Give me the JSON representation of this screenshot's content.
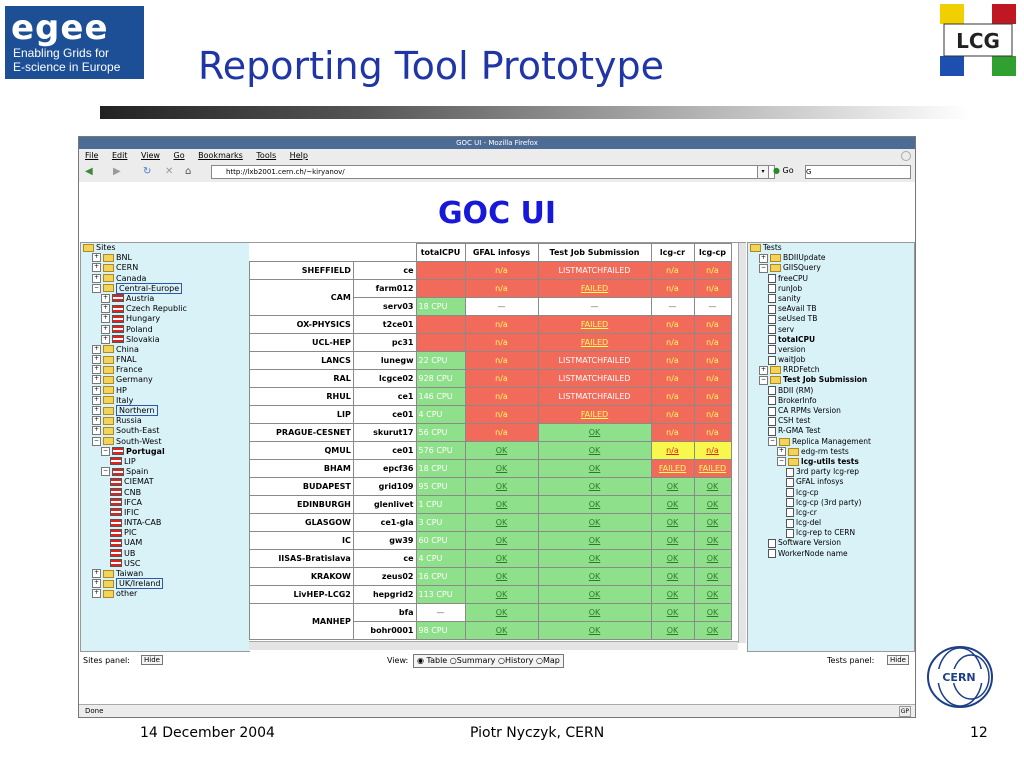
{
  "slide": {
    "logo_word": "egee",
    "logo_sub_line1": "Enabling Grids for",
    "logo_sub_line2": "E-science in Europe",
    "title": "Reporting Tool Prototype",
    "lcg_label": "LCG",
    "cern_label": "CERN",
    "footer_date": "14 December 2004",
    "footer_author": "Piotr Nyczyk, CERN",
    "footer_page": "12"
  },
  "browser": {
    "window_title": "GOC UI - Mozilla Firefox",
    "menu": [
      "File",
      "Edit",
      "View",
      "Go",
      "Bookmarks",
      "Tools",
      "Help"
    ],
    "url": "http://lxb2001.cern.ch/~kiryanov/",
    "go_label": "Go",
    "search_value": "G",
    "status_text": "Done",
    "status_right": "GP"
  },
  "page": {
    "heading": "GOC UI",
    "sites_panel_label": "Sites panel:",
    "tests_panel_label": "Tests panel:",
    "hide_label": "Hide",
    "view_label": "View:",
    "view_options": [
      "Table",
      "Summary",
      "History",
      "Map"
    ],
    "view_selected": "Table"
  },
  "sites_tree": [
    {
      "label": "Sites",
      "depth": 0,
      "icon": "folder"
    },
    {
      "label": "BNL",
      "depth": 1,
      "icon": "folder"
    },
    {
      "label": "CERN",
      "depth": 1,
      "icon": "folder"
    },
    {
      "label": "Canada",
      "depth": 1,
      "icon": "folder"
    },
    {
      "label": "Central-Europe",
      "depth": 1,
      "icon": "folder",
      "selected": true
    },
    {
      "label": "Austria",
      "depth": 2,
      "icon": "flag"
    },
    {
      "label": "Czech Republic",
      "depth": 2,
      "icon": "flag"
    },
    {
      "label": "Hungary",
      "depth": 2,
      "icon": "flag"
    },
    {
      "label": "Poland",
      "depth": 2,
      "icon": "flag"
    },
    {
      "label": "Slovakia",
      "depth": 2,
      "icon": "flag"
    },
    {
      "label": "China",
      "depth": 1,
      "icon": "folder"
    },
    {
      "label": "FNAL",
      "depth": 1,
      "icon": "folder"
    },
    {
      "label": "France",
      "depth": 1,
      "icon": "folder"
    },
    {
      "label": "Germany",
      "depth": 1,
      "icon": "folder"
    },
    {
      "label": "HP",
      "depth": 1,
      "icon": "folder"
    },
    {
      "label": "Italy",
      "depth": 1,
      "icon": "folder"
    },
    {
      "label": "Northern",
      "depth": 1,
      "icon": "folder",
      "selected": true
    },
    {
      "label": "Russia",
      "depth": 1,
      "icon": "folder"
    },
    {
      "label": "South-East",
      "depth": 1,
      "icon": "folder"
    },
    {
      "label": "South-West",
      "depth": 1,
      "icon": "folder"
    },
    {
      "label": "Portugal",
      "depth": 2,
      "icon": "flag",
      "bold": true
    },
    {
      "label": "LIP",
      "depth": 3,
      "icon": "flag"
    },
    {
      "label": "Spain",
      "depth": 2,
      "icon": "flag"
    },
    {
      "label": "CIEMAT",
      "depth": 3,
      "icon": "flag"
    },
    {
      "label": "CNB",
      "depth": 3,
      "icon": "flag"
    },
    {
      "label": "IFCA",
      "depth": 3,
      "icon": "flag"
    },
    {
      "label": "IFIC",
      "depth": 3,
      "icon": "flag"
    },
    {
      "label": "INTA-CAB",
      "depth": 3,
      "icon": "flag"
    },
    {
      "label": "PIC",
      "depth": 3,
      "icon": "flag"
    },
    {
      "label": "UAM",
      "depth": 3,
      "icon": "flag"
    },
    {
      "label": "UB",
      "depth": 3,
      "icon": "flag"
    },
    {
      "label": "USC",
      "depth": 3,
      "icon": "flag"
    },
    {
      "label": "Taiwan",
      "depth": 1,
      "icon": "folder"
    },
    {
      "label": "UK/Ireland",
      "depth": 1,
      "icon": "folder",
      "selected": true
    },
    {
      "label": "other",
      "depth": 1,
      "icon": "folder"
    }
  ],
  "tests_tree": [
    {
      "label": "Tests",
      "depth": 0,
      "icon": "folder"
    },
    {
      "label": "BDIIUpdate",
      "depth": 1,
      "icon": "folder"
    },
    {
      "label": "GIISQuery",
      "depth": 1,
      "icon": "folder"
    },
    {
      "label": "freeCPU",
      "depth": 2,
      "icon": "doc"
    },
    {
      "label": "runJob",
      "depth": 2,
      "icon": "doc"
    },
    {
      "label": "sanity",
      "depth": 2,
      "icon": "doc"
    },
    {
      "label": "seAvail TB",
      "depth": 2,
      "icon": "doc"
    },
    {
      "label": "seUsed TB",
      "depth": 2,
      "icon": "doc"
    },
    {
      "label": "serv",
      "depth": 2,
      "icon": "doc"
    },
    {
      "label": "totalCPU",
      "depth": 2,
      "icon": "doc",
      "bold": true
    },
    {
      "label": "version",
      "depth": 2,
      "icon": "doc"
    },
    {
      "label": "waitJob",
      "depth": 2,
      "icon": "doc"
    },
    {
      "label": "RRDFetch",
      "depth": 1,
      "icon": "folder"
    },
    {
      "label": "Test Job Submission",
      "depth": 1,
      "icon": "folder",
      "bold": true
    },
    {
      "label": "BDII (RM)",
      "depth": 2,
      "icon": "doc"
    },
    {
      "label": "BrokerInfo",
      "depth": 2,
      "icon": "doc"
    },
    {
      "label": "CA RPMs Version",
      "depth": 2,
      "icon": "doc"
    },
    {
      "label": "CSH test",
      "depth": 2,
      "icon": "doc"
    },
    {
      "label": "R-GMA Test",
      "depth": 2,
      "icon": "doc"
    },
    {
      "label": "Replica Management",
      "depth": 2,
      "icon": "folder"
    },
    {
      "label": "edg-rm tests",
      "depth": 3,
      "icon": "folder"
    },
    {
      "label": "lcg-utils tests",
      "depth": 3,
      "icon": "folder",
      "bold": true
    },
    {
      "label": "3rd party lcg-rep",
      "depth": 4,
      "icon": "doc"
    },
    {
      "label": "GFAL infosys",
      "depth": 4,
      "icon": "doc"
    },
    {
      "label": "lcg-cp",
      "depth": 4,
      "icon": "doc"
    },
    {
      "label": "lcg-cp (3rd party)",
      "depth": 4,
      "icon": "doc"
    },
    {
      "label": "lcg-cr",
      "depth": 4,
      "icon": "doc"
    },
    {
      "label": "lcg-del",
      "depth": 4,
      "icon": "doc"
    },
    {
      "label": "lcg-rep to CERN",
      "depth": 4,
      "icon": "doc"
    },
    {
      "label": "Software Version",
      "depth": 2,
      "icon": "doc"
    },
    {
      "label": "WorkerNode name",
      "depth": 2,
      "icon": "doc"
    }
  ],
  "table": {
    "columns": [
      "totalCPU",
      "GFAL infosys",
      "Test Job Submission",
      "lcg-cr",
      "lcg-cp"
    ],
    "rows": [
      {
        "site": "SHEFFIELD",
        "host": "ce",
        "cells": [
          [
            "",
            "red"
          ],
          [
            "n/a",
            "red"
          ],
          [
            "LISTMATCHFAILED",
            "red"
          ],
          [
            "n/a",
            "red"
          ],
          [
            "n/a",
            "red"
          ]
        ]
      },
      {
        "site": "CAM",
        "host": "farm012",
        "cells": [
          [
            "",
            "red"
          ],
          [
            "n/a",
            "red"
          ],
          [
            "FAILED",
            "redu"
          ],
          [
            "n/a",
            "red"
          ],
          [
            "n/a",
            "red"
          ]
        ]
      },
      {
        "site": "",
        "host": "serv03",
        "cells": [
          [
            "18 CPU",
            "green"
          ],
          [
            "—",
            "white"
          ],
          [
            "—",
            "white"
          ],
          [
            "—",
            "white"
          ],
          [
            "—",
            "white"
          ]
        ]
      },
      {
        "site": "OX-PHYSICS",
        "host": "t2ce01",
        "cells": [
          [
            "",
            "red"
          ],
          [
            "n/a",
            "red"
          ],
          [
            "FAILED",
            "redu"
          ],
          [
            "n/a",
            "red"
          ],
          [
            "n/a",
            "red"
          ]
        ]
      },
      {
        "site": "UCL-HEP",
        "host": "pc31",
        "cells": [
          [
            "",
            "red"
          ],
          [
            "n/a",
            "red"
          ],
          [
            "FAILED",
            "redu"
          ],
          [
            "n/a",
            "red"
          ],
          [
            "n/a",
            "red"
          ]
        ]
      },
      {
        "site": "LANCS",
        "host": "lunegw",
        "cells": [
          [
            "22 CPU",
            "green"
          ],
          [
            "n/a",
            "red"
          ],
          [
            "LISTMATCHFAILED",
            "red"
          ],
          [
            "n/a",
            "red"
          ],
          [
            "n/a",
            "red"
          ]
        ]
      },
      {
        "site": "RAL",
        "host": "lcgce02",
        "cells": [
          [
            "928 CPU",
            "green"
          ],
          [
            "n/a",
            "red"
          ],
          [
            "LISTMATCHFAILED",
            "red"
          ],
          [
            "n/a",
            "red"
          ],
          [
            "n/a",
            "red"
          ]
        ]
      },
      {
        "site": "RHUL",
        "host": "ce1",
        "cells": [
          [
            "146 CPU",
            "green"
          ],
          [
            "n/a",
            "red"
          ],
          [
            "LISTMATCHFAILED",
            "red"
          ],
          [
            "n/a",
            "red"
          ],
          [
            "n/a",
            "red"
          ]
        ]
      },
      {
        "site": "LIP",
        "host": "ce01",
        "cells": [
          [
            "4 CPU",
            "green"
          ],
          [
            "n/a",
            "red"
          ],
          [
            "FAILED",
            "redu"
          ],
          [
            "n/a",
            "red"
          ],
          [
            "n/a",
            "red"
          ]
        ]
      },
      {
        "site": "PRAGUE-CESNET",
        "host": "skurut17",
        "cells": [
          [
            "56 CPU",
            "green"
          ],
          [
            "n/a",
            "red"
          ],
          [
            "OK",
            "green"
          ],
          [
            "n/a",
            "red"
          ],
          [
            "n/a",
            "red"
          ]
        ]
      },
      {
        "site": "QMUL",
        "host": "ce01",
        "cells": [
          [
            "576 CPU",
            "green"
          ],
          [
            "OK",
            "green"
          ],
          [
            "OK",
            "green"
          ],
          [
            "n/a",
            "yellow"
          ],
          [
            "n/a",
            "yellow"
          ]
        ]
      },
      {
        "site": "BHAM",
        "host": "epcf36",
        "cells": [
          [
            "18 CPU",
            "green"
          ],
          [
            "OK",
            "green"
          ],
          [
            "OK",
            "green"
          ],
          [
            "FAILED",
            "redy"
          ],
          [
            "FAILED",
            "redy"
          ]
        ]
      },
      {
        "site": "BUDAPEST",
        "host": "grid109",
        "cells": [
          [
            "95 CPU",
            "green"
          ],
          [
            "OK",
            "green"
          ],
          [
            "OK",
            "green"
          ],
          [
            "OK",
            "green"
          ],
          [
            "OK",
            "green"
          ]
        ]
      },
      {
        "site": "EDINBURGH",
        "host": "glenlivet",
        "cells": [
          [
            "1 CPU",
            "green"
          ],
          [
            "OK",
            "green"
          ],
          [
            "OK",
            "green"
          ],
          [
            "OK",
            "green"
          ],
          [
            "OK",
            "green"
          ]
        ]
      },
      {
        "site": "GLASGOW",
        "host": "ce1-gla",
        "cells": [
          [
            "3 CPU",
            "green"
          ],
          [
            "OK",
            "green"
          ],
          [
            "OK",
            "green"
          ],
          [
            "OK",
            "green"
          ],
          [
            "OK",
            "green"
          ]
        ]
      },
      {
        "site": "IC",
        "host": "gw39",
        "cells": [
          [
            "60 CPU",
            "green"
          ],
          [
            "OK",
            "green"
          ],
          [
            "OK",
            "green"
          ],
          [
            "OK",
            "green"
          ],
          [
            "OK",
            "green"
          ]
        ]
      },
      {
        "site": "IISAS-Bratislava",
        "host": "ce",
        "cells": [
          [
            "4 CPU",
            "green"
          ],
          [
            "OK",
            "green"
          ],
          [
            "OK",
            "green"
          ],
          [
            "OK",
            "green"
          ],
          [
            "OK",
            "green"
          ]
        ]
      },
      {
        "site": "KRAKOW",
        "host": "zeus02",
        "cells": [
          [
            "16 CPU",
            "green"
          ],
          [
            "OK",
            "green"
          ],
          [
            "OK",
            "green"
          ],
          [
            "OK",
            "green"
          ],
          [
            "OK",
            "green"
          ]
        ]
      },
      {
        "site": "LivHEP-LCG2",
        "host": "hepgrid2",
        "cells": [
          [
            "113 CPU",
            "green"
          ],
          [
            "OK",
            "green"
          ],
          [
            "OK",
            "green"
          ],
          [
            "OK",
            "green"
          ],
          [
            "OK",
            "green"
          ]
        ]
      },
      {
        "site": "MANHEP",
        "host": "bfa",
        "cells": [
          [
            "—",
            "white"
          ],
          [
            "OK",
            "green"
          ],
          [
            "OK",
            "green"
          ],
          [
            "OK",
            "green"
          ],
          [
            "OK",
            "green"
          ]
        ]
      },
      {
        "site": "",
        "host": "bohr0001",
        "cells": [
          [
            "98 CPU",
            "green"
          ],
          [
            "OK",
            "green"
          ],
          [
            "OK",
            "green"
          ],
          [
            "OK",
            "green"
          ],
          [
            "OK",
            "green"
          ]
        ]
      }
    ]
  },
  "colors": {
    "slide_title": "#2036a6",
    "goc_heading": "#1818d8",
    "fail_red": "#f26a5a",
    "ok_green": "#8fe08a",
    "warn_yellow": "#f8f84c",
    "panel_blue": "#d9f2f8"
  }
}
